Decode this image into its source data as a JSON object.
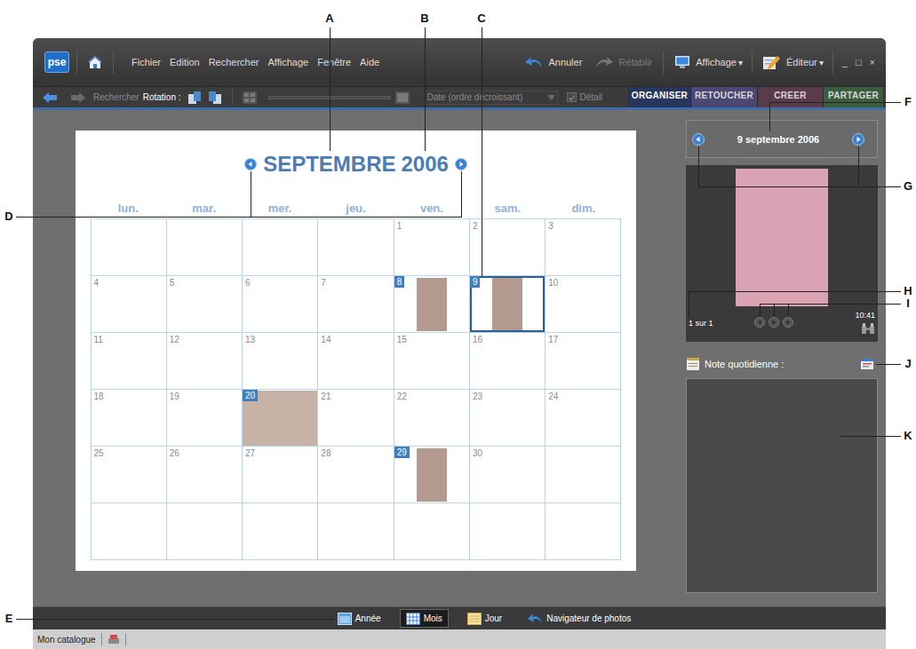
{
  "callouts": [
    "A",
    "B",
    "C",
    "D",
    "E",
    "F",
    "G",
    "H",
    "I",
    "J",
    "K"
  ],
  "app": {
    "logo": "pse",
    "menu": [
      "Fichier",
      "Edition",
      "Rechercher",
      "Affichage",
      "Fenêtre",
      "Aide"
    ],
    "undo": {
      "label": "Annuler",
      "disabled": false
    },
    "redo": {
      "label": "Rétablir",
      "disabled": true
    },
    "display": {
      "label": "Affichage",
      "arrow": "▾"
    },
    "editor": {
      "label": "Éditeur",
      "arrow": "▾"
    },
    "window_controls": [
      "_",
      "□",
      "×"
    ]
  },
  "toolbar": {
    "back_disabled": false,
    "forward_disabled": true,
    "search": {
      "label": "Rechercher",
      "disabled": true
    },
    "rotation": "Rotation :",
    "sort": {
      "label": "Date (ordre décroissant)",
      "disabled": true
    },
    "detail": {
      "label": "Détail",
      "checked": true,
      "disabled": true
    }
  },
  "modes": [
    {
      "label": "ORGANISER",
      "selected": true,
      "color": "#27365a"
    },
    {
      "label": "RETOUCHER",
      "selected": false,
      "color": "#4a4872"
    },
    {
      "label": "CREER",
      "selected": false,
      "color": "#5b3a4c"
    },
    {
      "label": "PARTAGER",
      "selected": false,
      "color": "#3c5c3e"
    }
  ],
  "calendar": {
    "month": "SEPTEMBRE",
    "year": "2006",
    "weekdays": [
      "lun.",
      "mar.",
      "mer.",
      "jeu.",
      "ven.",
      "sam.",
      "dim."
    ],
    "weeks": [
      [
        {
          "day": "",
          "kind": "blank",
          "selected": false
        },
        {
          "day": "",
          "kind": "blank",
          "selected": false
        },
        {
          "day": "",
          "kind": "blank",
          "selected": false
        },
        {
          "day": "",
          "kind": "blank",
          "selected": false
        },
        {
          "day": "1",
          "kind": "day",
          "selected": false
        },
        {
          "day": "2",
          "kind": "day",
          "selected": false
        },
        {
          "day": "3",
          "kind": "day",
          "selected": false
        }
      ],
      [
        {
          "day": "4",
          "kind": "day",
          "selected": false
        },
        {
          "day": "5",
          "kind": "day",
          "selected": false
        },
        {
          "day": "6",
          "kind": "day",
          "selected": false
        },
        {
          "day": "7",
          "kind": "day",
          "selected": false
        },
        {
          "day": "8",
          "kind": "photo-portrait",
          "selected": false
        },
        {
          "day": "9",
          "kind": "photo-portrait",
          "selected": true
        },
        {
          "day": "10",
          "kind": "day",
          "selected": false
        }
      ],
      [
        {
          "day": "11",
          "kind": "day",
          "selected": false
        },
        {
          "day": "12",
          "kind": "day",
          "selected": false
        },
        {
          "day": "13",
          "kind": "day",
          "selected": false
        },
        {
          "day": "14",
          "kind": "day",
          "selected": false
        },
        {
          "day": "15",
          "kind": "day",
          "selected": false
        },
        {
          "day": "16",
          "kind": "day",
          "selected": false
        },
        {
          "day": "17",
          "kind": "day",
          "selected": false
        }
      ],
      [
        {
          "day": "18",
          "kind": "day",
          "selected": false
        },
        {
          "day": "19",
          "kind": "day",
          "selected": false
        },
        {
          "day": "20",
          "kind": "photo-landscape",
          "selected": false
        },
        {
          "day": "21",
          "kind": "day",
          "selected": false
        },
        {
          "day": "22",
          "kind": "day",
          "selected": false
        },
        {
          "day": "23",
          "kind": "day",
          "selected": false
        },
        {
          "day": "24",
          "kind": "day",
          "selected": false
        }
      ],
      [
        {
          "day": "25",
          "kind": "day",
          "selected": false
        },
        {
          "day": "26",
          "kind": "day",
          "selected": false
        },
        {
          "day": "27",
          "kind": "day",
          "selected": false
        },
        {
          "day": "28",
          "kind": "day",
          "selected": false
        },
        {
          "day": "29",
          "kind": "photo-portrait",
          "selected": false
        },
        {
          "day": "30",
          "kind": "day",
          "selected": false
        },
        {
          "day": "",
          "kind": "blank",
          "selected": false
        }
      ],
      [
        {
          "day": "",
          "kind": "blank",
          "selected": false
        },
        {
          "day": "",
          "kind": "blank",
          "selected": false
        },
        {
          "day": "",
          "kind": "blank",
          "selected": false
        },
        {
          "day": "",
          "kind": "blank",
          "selected": false
        },
        {
          "day": "",
          "kind": "blank",
          "selected": false
        },
        {
          "day": "",
          "kind": "blank",
          "selected": false
        },
        {
          "day": "",
          "kind": "blank",
          "selected": false
        }
      ]
    ]
  },
  "side": {
    "date": "9 septembre 2006",
    "counter": "1 sur 1",
    "time": "10:41",
    "note_label": "Note quotidienne :"
  },
  "views": [
    {
      "label": "Année",
      "selected": false
    },
    {
      "label": "Mois",
      "selected": true
    },
    {
      "label": "Jour",
      "selected": false
    },
    {
      "label": "Navigateur de photos",
      "selected": false
    }
  ],
  "status": {
    "catalog": "Mon catalogue"
  }
}
